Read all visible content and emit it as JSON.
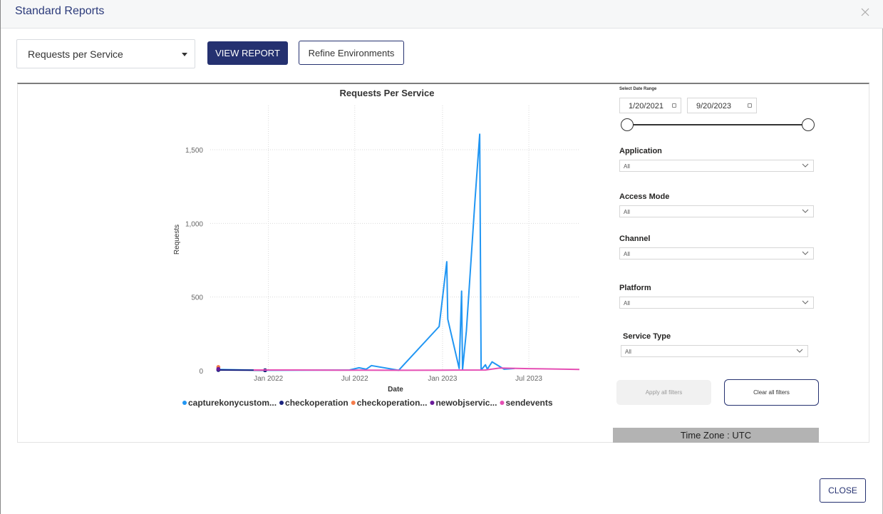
{
  "modal": {
    "title": "Standard Reports",
    "close_icon": "close-icon"
  },
  "toolbar": {
    "report_select_value": "Requests per Service",
    "view_report_label": "VIEW REPORT",
    "refine_label": "Refine Environments"
  },
  "filters": {
    "date_range_label": "Select Date Range",
    "start_date": "1/20/2021",
    "end_date": "9/20/2023",
    "range_position": {
      "start": 0,
      "end": 1
    },
    "application": {
      "label": "Application",
      "value": "All"
    },
    "access_mode": {
      "label": "Access Mode",
      "value": "All"
    },
    "channel": {
      "label": "Channel",
      "value": "All"
    },
    "platform": {
      "label": "Platform",
      "value": "All"
    },
    "service_type": {
      "label": "Service Type",
      "value": "All"
    },
    "apply_label": "Apply all filters",
    "clear_label": "Clear all filters",
    "time_zone": "Time Zone : UTC"
  },
  "footer": {
    "close_label": "CLOSE"
  },
  "chart_data": {
    "type": "line",
    "title": "Requests Per Service",
    "xlabel": "Date",
    "ylabel": "Requests",
    "x_ticks": [
      "Jan 2022",
      "Jul 2022",
      "Jan 2023",
      "Jul 2023"
    ],
    "y_ticks": [
      "0",
      "500",
      "1,000",
      "1,500"
    ],
    "ylim": [
      0,
      1800
    ],
    "xlim": [
      "2021-09-01",
      "2023-10-15"
    ],
    "grid": true,
    "legend_position": "bottom",
    "series": [
      {
        "name": "capturekonycustom...",
        "color": "#2196f3",
        "points": [
          [
            "2021-09-15",
            8
          ],
          [
            "2021-12-20",
            3
          ],
          [
            "2022-06-20",
            5
          ],
          [
            "2022-07-10",
            20
          ],
          [
            "2022-07-25",
            10
          ],
          [
            "2022-08-05",
            35
          ],
          [
            "2022-10-01",
            3
          ],
          [
            "2022-12-25",
            300
          ],
          [
            "2023-01-10",
            740
          ],
          [
            "2023-01-12",
            350
          ],
          [
            "2023-02-05",
            15
          ],
          [
            "2023-02-10",
            540
          ],
          [
            "2023-02-12",
            5
          ],
          [
            "2023-02-20",
            270
          ],
          [
            "2023-03-10",
            1150
          ],
          [
            "2023-03-20",
            1605
          ],
          [
            "2023-03-23",
            5
          ],
          [
            "2023-04-01",
            40
          ],
          [
            "2023-04-05",
            10
          ],
          [
            "2023-04-15",
            60
          ],
          [
            "2023-05-10",
            10
          ],
          [
            "2023-06-01",
            15
          ]
        ]
      },
      {
        "name": "checkoperation",
        "color": "#1a237e",
        "points": [
          [
            "2021-09-18",
            5
          ],
          [
            "2021-12-25",
            3
          ]
        ]
      },
      {
        "name": "checkoperation...",
        "color": "#f57c4a",
        "points": [
          [
            "2021-09-18",
            25
          ]
        ]
      },
      {
        "name": "newobjservic...",
        "color": "#6a1b9a",
        "points": [
          [
            "2021-09-18",
            12
          ]
        ]
      },
      {
        "name": "sendevents",
        "color": "#e54fb4",
        "points": [
          [
            "2021-12-01",
            5
          ],
          [
            "2022-03-01",
            5
          ],
          [
            "2022-06-01",
            4
          ],
          [
            "2022-10-01",
            3
          ],
          [
            "2023-01-01",
            4
          ],
          [
            "2023-04-01",
            5
          ],
          [
            "2023-05-01",
            18
          ],
          [
            "2023-07-01",
            14
          ],
          [
            "2023-09-15",
            10
          ],
          [
            "2023-10-15",
            8
          ]
        ]
      }
    ]
  }
}
